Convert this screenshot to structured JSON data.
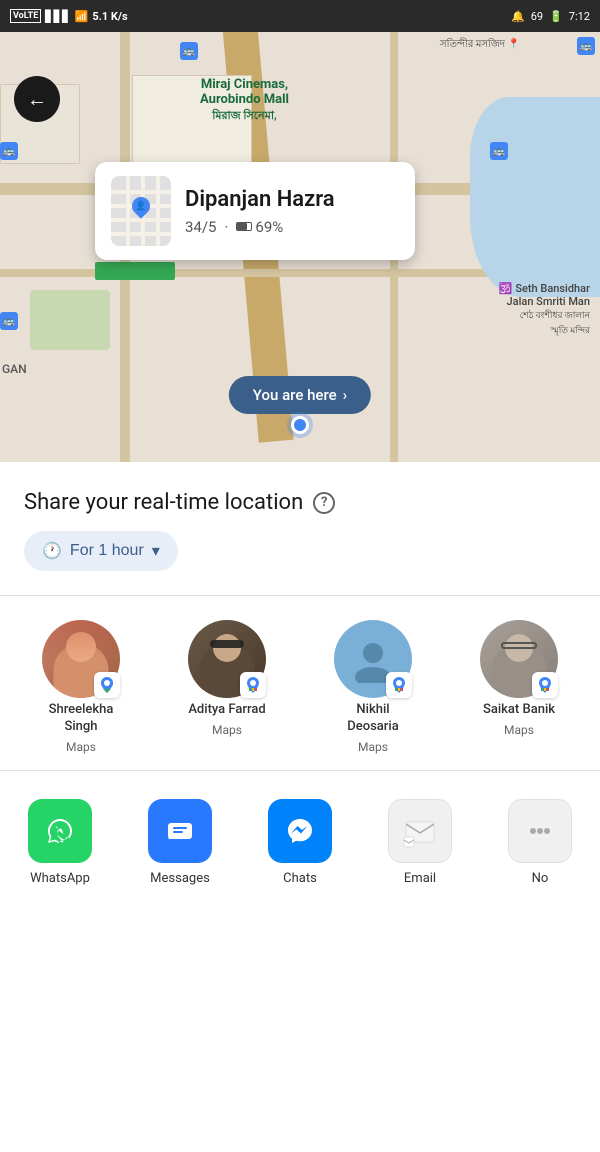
{
  "statusBar": {
    "carrier": "VoLTE",
    "signal": "4G",
    "wifi": "5.1 K/s",
    "battery": "69",
    "time": "7:12"
  },
  "map": {
    "backButton": "←",
    "locationCard": {
      "name": "Dipanjan Hazra",
      "rating": "34/5",
      "battery": "69%"
    },
    "youAreHere": "You are here",
    "labels": {
      "cinemas": "Miraj Cinemas,\nAurobindo Mall",
      "cinemasLocal": "মিরাজ সিনেমা,",
      "seth": "Seth Bansidhar\nJalan Smriti Man",
      "sethLocal": "শেঠ বংশীধর জালান\nস্মৃতি মন্দির",
      "gan": "GAN",
      "masjid": "সতিন্দীর মসজিদ"
    }
  },
  "bottomSheet": {
    "shareTitle": "Share your real-time location",
    "durationLabel": "For 1 hour",
    "helpIcon": "?",
    "contacts": [
      {
        "name": "Shreelekha Singh",
        "app": "Maps",
        "avatarType": "photo-female"
      },
      {
        "name": "Aditya Farrad",
        "app": "Maps",
        "avatarType": "photo-male"
      },
      {
        "name": "Nikhil Deosaria",
        "app": "Maps",
        "avatarType": "placeholder"
      },
      {
        "name": "Saikat Banik",
        "app": "Maps",
        "avatarType": "photo-male2"
      }
    ],
    "apps": [
      {
        "name": "WhatsApp",
        "iconType": "whatsapp"
      },
      {
        "name": "Messages",
        "iconType": "messages"
      },
      {
        "name": "Chats",
        "iconType": "messenger"
      },
      {
        "name": "Email",
        "iconType": "email"
      },
      {
        "name": "No",
        "iconType": "more"
      }
    ]
  },
  "colors": {
    "accent": "#4285F4",
    "green": "#34a853",
    "whatsapp": "#25d366",
    "messenger": "#0082FB",
    "messages": "#2979ff"
  }
}
